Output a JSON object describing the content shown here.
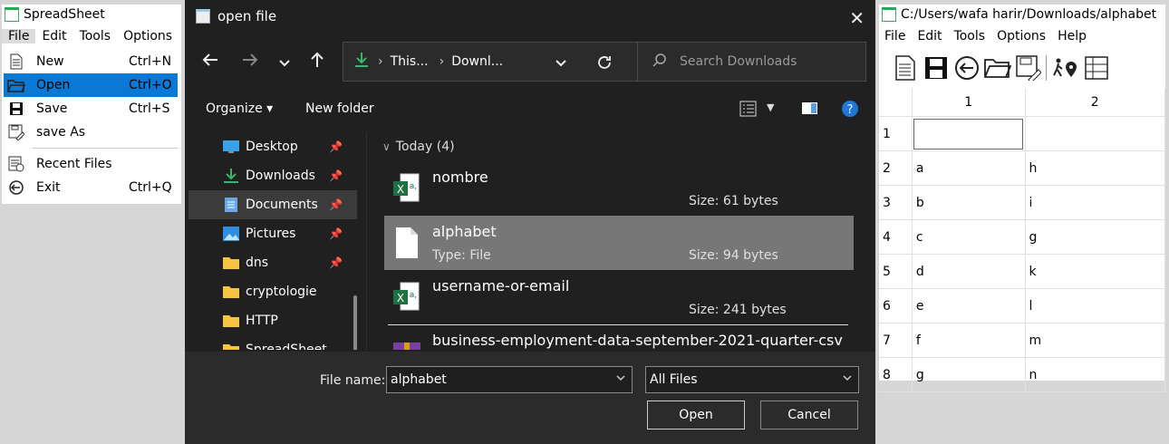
{
  "left_window": {
    "title": "SpreadSheet",
    "menubar": [
      "File",
      "Edit",
      "Tools",
      "Options"
    ],
    "file_menu": [
      {
        "label": "New",
        "shortcut": "Ctrl+N",
        "icon": "new-document-icon"
      },
      {
        "label": "Open",
        "shortcut": "Ctrl+O",
        "icon": "open-folder-icon",
        "selected": true
      },
      {
        "label": "Save",
        "shortcut": "Ctrl+S",
        "icon": "save-disk-icon"
      },
      {
        "label": "save As",
        "shortcut": "",
        "icon": "save-as-icon"
      },
      {
        "label": "Recent Files",
        "shortcut": "",
        "icon": "recent-files-icon"
      },
      {
        "label": "Exit",
        "shortcut": "Ctrl+Q",
        "icon": "exit-icon"
      }
    ]
  },
  "dialog": {
    "title": "open file",
    "breadcrumb": [
      "This...",
      "Downl..."
    ],
    "search_placeholder": "Search Downloads",
    "toolbar": {
      "organize": "Organize",
      "new_folder": "New folder"
    },
    "sidebar": [
      {
        "label": "Desktop",
        "icon": "desktop-icon",
        "pinned": true
      },
      {
        "label": "Downloads",
        "icon": "download-icon",
        "pinned": true
      },
      {
        "label": "Documents",
        "icon": "documents-icon",
        "pinned": true,
        "selected": true
      },
      {
        "label": "Pictures",
        "icon": "pictures-icon",
        "pinned": true
      },
      {
        "label": "dns",
        "icon": "folder-icon",
        "pinned": true
      },
      {
        "label": "cryptologie",
        "icon": "folder-icon",
        "pinned": false
      },
      {
        "label": "HTTP",
        "icon": "folder-icon",
        "pinned": false
      },
      {
        "label": "SpreadSheet",
        "icon": "folder-icon",
        "pinned": false
      }
    ],
    "group_header": "Today (4)",
    "files": [
      {
        "name": "nombre",
        "type": "",
        "size": "Size: 61 bytes",
        "icon": "excel-file-icon"
      },
      {
        "name": "alphabet",
        "type": "Type: File",
        "size": "Size: 94 bytes",
        "icon": "blank-file-icon",
        "selected": true
      },
      {
        "name": "username-or-email",
        "type": "",
        "size": "Size: 241 bytes",
        "icon": "excel-file-icon"
      },
      {
        "name": "business-employment-data-september-2021-quarter-csv",
        "type": "",
        "size": "",
        "icon": "winrar-archive-icon"
      }
    ],
    "file_name_label": "File name:",
    "file_name_value": "alphabet",
    "file_type_value": "All Files",
    "open_button": "Open",
    "cancel_button": "Cancel"
  },
  "right_window": {
    "title": "C:/Users/wafa harir/Downloads/alphabet",
    "menubar": [
      "File",
      "Edit",
      "Tools",
      "Options",
      "Help"
    ],
    "columns": [
      "1",
      "2"
    ],
    "rows": [
      {
        "n": "1",
        "c1": "",
        "c2": ""
      },
      {
        "n": "2",
        "c1": "a",
        "c2": "h"
      },
      {
        "n": "3",
        "c1": "b",
        "c2": "i"
      },
      {
        "n": "4",
        "c1": "c",
        "c2": "g"
      },
      {
        "n": "5",
        "c1": "d",
        "c2": "k"
      },
      {
        "n": "6",
        "c1": "e",
        "c2": "l"
      },
      {
        "n": "7",
        "c1": "f",
        "c2": "m"
      },
      {
        "n": "8",
        "c1": "g",
        "c2": "n"
      }
    ]
  }
}
